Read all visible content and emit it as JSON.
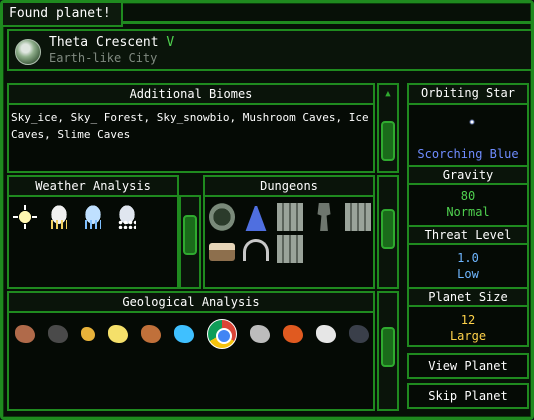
{
  "window": {
    "title": "Found planet!"
  },
  "planet": {
    "name": "Theta Crescent",
    "tier": "V",
    "type": "Earth-like City"
  },
  "biomes": {
    "title": "Additional Biomes",
    "text": "Sky_ice, Sky_ Forest, Sky_snowbio, Mushroom Caves, Ice Caves, Slime Caves"
  },
  "weather": {
    "title": "Weather Analysis",
    "icons": [
      "sun-icon",
      "rain-cloud-icon",
      "storm-cloud-icon",
      "snow-cloud-icon"
    ]
  },
  "dungeons": {
    "title": "Dungeons",
    "icons": [
      "stone-gate-icon",
      "blue-spire-icon",
      "ruined-tower-icon",
      "statue-icon",
      "ruined-tower-icon",
      "bed-icon",
      "arch-icon",
      "ruined-tower-icon"
    ]
  },
  "geology": {
    "title": "Geological Analysis",
    "icons": [
      "copper-ore-icon",
      "coal-ore-icon",
      "gold-ore-icon",
      "sulfur-ore-icon",
      "iron-ore-icon",
      "diamond-ore-icon",
      "chrome-icon",
      "silver-ore-icon",
      "fire-ore-icon",
      "platinum-ore-icon",
      "dark-ore-icon"
    ]
  },
  "info": {
    "orbiting_star_label": "Orbiting Star",
    "star_name": "Scorching Blue",
    "gravity_label": "Gravity",
    "gravity_value": "80",
    "gravity_desc": "Normal",
    "threat_label": "Threat Level",
    "threat_value": "1.0",
    "threat_desc": "Low",
    "size_label": "Planet Size",
    "size_value": "12",
    "size_desc": "Large"
  },
  "buttons": {
    "view": "View Planet",
    "skip": "Skip Planet"
  },
  "colors": {
    "frame_green": "#1f8a1f",
    "tier_green": "#4fd14f",
    "star_blue": "#6f8cff",
    "gravity_green": "#4fd14f",
    "threat_blue": "#6fb6ff",
    "size_yellow": "#ffd24a"
  }
}
